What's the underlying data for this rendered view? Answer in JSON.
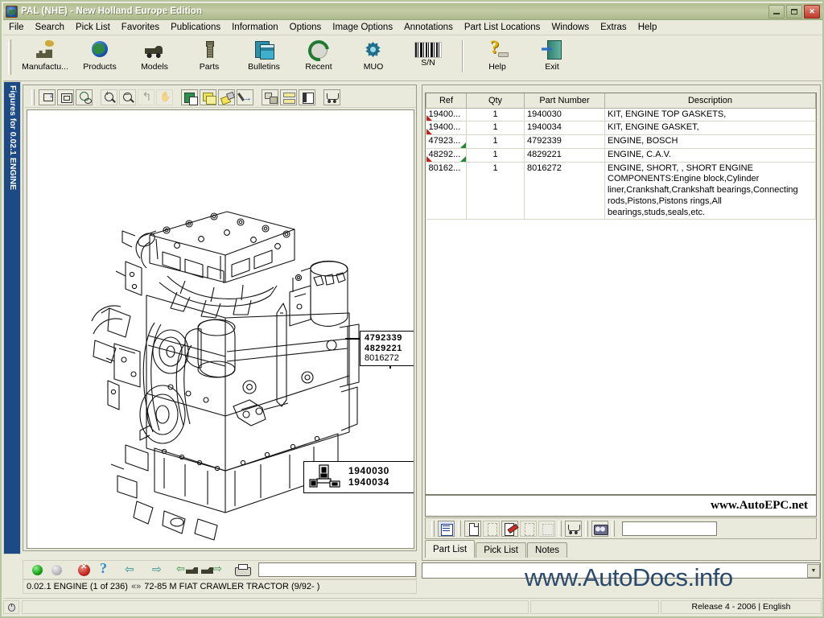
{
  "window": {
    "title": "PAL (NHE) - New Holland Europe Edition",
    "app_icon": "globe-app-icon",
    "minimize_label": "Minimize",
    "restore_label": "Restore",
    "close_label": "✕"
  },
  "menubar": {
    "items": [
      {
        "label": "File"
      },
      {
        "label": "Search"
      },
      {
        "label": "Pick List"
      },
      {
        "label": "Favorites"
      },
      {
        "label": "Publications"
      },
      {
        "label": "Information"
      },
      {
        "label": "Options"
      },
      {
        "label": "Image Options"
      },
      {
        "label": "Annotations"
      },
      {
        "label": "Part List Locations"
      },
      {
        "label": "Windows"
      },
      {
        "label": "Extras"
      },
      {
        "label": "Help"
      }
    ]
  },
  "toolbar": {
    "buttons": [
      {
        "label": "Manufactu...",
        "icon": "factory-icon"
      },
      {
        "label": "Products",
        "icon": "globe-icon"
      },
      {
        "label": "Models",
        "icon": "truck-icon"
      },
      {
        "label": "Parts",
        "icon": "bolt-icon"
      },
      {
        "label": "Bulletins",
        "icon": "bulletin-documents-icon"
      },
      {
        "label": "Recent",
        "icon": "refresh-clock-icon"
      },
      {
        "label": "MUO",
        "icon": "gear-star-icon"
      },
      {
        "label": "S/N",
        "icon": "barcode-icon"
      }
    ],
    "right_buttons": [
      {
        "label": "Help",
        "icon": "question-mark-help-icon"
      },
      {
        "label": "Exit",
        "icon": "exit-door-icon"
      }
    ]
  },
  "figure_panel": {
    "dock_label": "Figures for 0.02.1 ENGINE",
    "image_toolbar": [
      {
        "icon": "fit-width-icon",
        "enabled": true
      },
      {
        "icon": "fit-page-icon",
        "enabled": true
      },
      {
        "icon": "lasso-select-icon",
        "enabled": true
      },
      {
        "icon": "zoom-in-icon",
        "enabled": true
      },
      {
        "icon": "zoom-out-icon",
        "enabled": true
      },
      {
        "icon": "undo-icon",
        "enabled": false
      },
      {
        "icon": "pan-hand-icon",
        "enabled": false
      },
      {
        "icon": "hotspot-icon",
        "enabled": true
      },
      {
        "icon": "layers-icon",
        "enabled": true
      },
      {
        "icon": "highlighter-icon",
        "enabled": true
      },
      {
        "icon": "pen-annotate-icon",
        "enabled": true
      },
      {
        "icon": "split-view-icon",
        "enabled": true
      },
      {
        "icon": "stacked-view-icon",
        "enabled": true
      },
      {
        "icon": "side-panel-icon",
        "enabled": true
      },
      {
        "icon": "shopping-cart-icon",
        "enabled": true
      }
    ],
    "diagram": {
      "alt": "Exploded line drawing of a 4-cylinder diesel engine assembly",
      "callouts": [
        {
          "id": "callout-engine-assy",
          "lines": [
            "4792339",
            "4829221",
            "8016272"
          ],
          "bold_count": 2
        },
        {
          "id": "callout-gasket-kits",
          "lines": [
            "1940030",
            "1940034"
          ],
          "bold_count": 2
        }
      ]
    },
    "nav_toolbar": [
      {
        "icon": "status-green-ball-icon"
      },
      {
        "icon": "status-grey-ball-icon"
      },
      {
        "icon": "stop-cancel-icon"
      },
      {
        "icon": "question-help-icon"
      },
      {
        "icon": "arrow-left-icon"
      },
      {
        "icon": "arrow-right-icon"
      },
      {
        "icon": "previous-model-icon"
      },
      {
        "icon": "next-model-icon"
      },
      {
        "icon": "print-icon"
      }
    ],
    "nav_input_value": "",
    "nav_input_placeholder": "",
    "status": {
      "figure": "0.02.1 ENGINE (1 of 236)",
      "separator": "«»",
      "model": "72-85 M FIAT CRAWLER TRACTOR (9/92- )"
    }
  },
  "parts_panel": {
    "columns": [
      "Ref",
      "Qty",
      "Part Number",
      "Description"
    ],
    "rows": [
      {
        "ref": "19400...",
        "qty": "1",
        "part_number": "1940030",
        "description": "KIT, ENGINE TOP GASKETS,",
        "marker_red": true,
        "marker_green": false
      },
      {
        "ref": "19400...",
        "qty": "1",
        "part_number": "1940034",
        "description": "KIT, ENGINE GASKET,",
        "marker_red": true,
        "marker_green": false
      },
      {
        "ref": "47923...",
        "qty": "1",
        "part_number": "4792339",
        "description": "ENGINE, BOSCH",
        "marker_red": false,
        "marker_green": true
      },
      {
        "ref": "48292...",
        "qty": "1",
        "part_number": "4829221",
        "description": "ENGINE, C.A.V.",
        "marker_red": true,
        "marker_green": true
      },
      {
        "ref": "80162...",
        "qty": "1",
        "part_number": "8016272",
        "description": "ENGINE, SHORT, , SHORT ENGINE COMPONENTS:Engine block,Cylinder liner,Crankshaft,Crankshaft bearings,Connecting rods,Pistons,Pistons rings,All bearings,studs,seals,etc.",
        "marker_red": false,
        "marker_green": false
      }
    ],
    "watermark": "www.AutoEPC.net",
    "bottom_toolbar": [
      {
        "icon": "part-list-view-icon",
        "enabled": true
      },
      {
        "icon": "new-document-icon",
        "enabled": true
      },
      {
        "icon": "document-plain-icon",
        "enabled": false
      },
      {
        "icon": "edit-document-icon",
        "enabled": true
      },
      {
        "icon": "copy-document-icon",
        "enabled": false
      },
      {
        "icon": "paste-document-icon",
        "enabled": false
      },
      {
        "icon": "add-to-cart-icon",
        "enabled": true
      },
      {
        "icon": "find-binoculars-icon",
        "enabled": true
      }
    ],
    "search_value": "",
    "search_placeholder": "",
    "tabs": [
      {
        "label": "Part List",
        "active": true
      },
      {
        "label": "Pick List",
        "active": false
      },
      {
        "label": "Notes",
        "active": false
      }
    ]
  },
  "bottom": {
    "combo_value": "",
    "combo_arrow": "▼",
    "watermark": "www.AutoDocs.info",
    "mouse_icon": "mouse-pointer-icon"
  },
  "statusbar": {
    "cell1": "",
    "cell2": "",
    "release": "Release 4 - 2006 | English"
  },
  "colors": {
    "titlebar": "#b0bb8f",
    "window_bg": "#e9e9dc",
    "dock_blue": "#1c4a86",
    "marker_red": "#c0221a",
    "marker_green": "#1f8a2f",
    "watermark_blue": "#2c4a6e",
    "close_red": "#c0392b"
  }
}
